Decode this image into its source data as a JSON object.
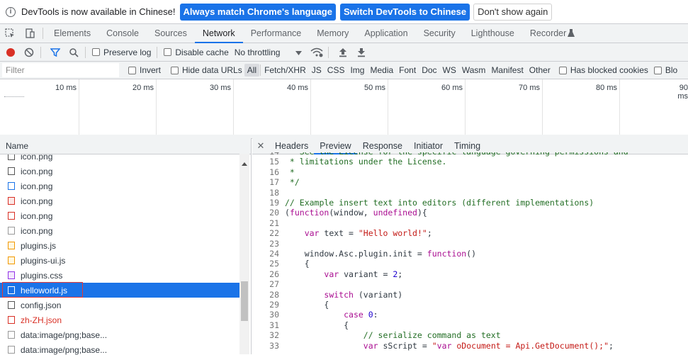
{
  "infobar": {
    "message": "DevTools is now available in Chinese!",
    "btn_match": "Always match Chrome's language",
    "btn_switch": "Switch DevTools to Chinese",
    "btn_dont": "Don't show again"
  },
  "tabs": [
    "Elements",
    "Console",
    "Sources",
    "Network",
    "Performance",
    "Memory",
    "Application",
    "Security",
    "Lighthouse",
    "Recorder"
  ],
  "active_tab": "Network",
  "toolbar": {
    "preserve_log": "Preserve log",
    "disable_cache": "Disable cache",
    "throttling": "No throttling"
  },
  "filterbar": {
    "placeholder": "Filter",
    "invert": "Invert",
    "hide_data_urls": "Hide data URLs",
    "types": [
      "All",
      "Fetch/XHR",
      "JS",
      "CSS",
      "Img",
      "Media",
      "Font",
      "Doc",
      "WS",
      "Wasm",
      "Manifest",
      "Other"
    ],
    "has_blocked_cookies": "Has blocked cookies",
    "blocked_trunc": "Blo"
  },
  "overview": {
    "ticks": [
      "10 ms",
      "20 ms",
      "30 ms",
      "40 ms",
      "50 ms",
      "60 ms",
      "70 ms",
      "80 ms",
      "90 ms"
    ]
  },
  "list": {
    "header": "Name",
    "items": [
      {
        "name": "icon.png",
        "type": "img"
      },
      {
        "name": "icon.png",
        "type": "img"
      },
      {
        "name": "icon.png",
        "type": "img"
      },
      {
        "name": "icon.png",
        "type": "img"
      },
      {
        "name": "icon.png",
        "type": "img"
      },
      {
        "name": "icon.png",
        "type": "img"
      },
      {
        "name": "plugins.js",
        "type": "js"
      },
      {
        "name": "plugins-ui.js",
        "type": "js"
      },
      {
        "name": "plugins.css",
        "type": "css"
      },
      {
        "name": "helloworld.js",
        "type": "js",
        "selected": true
      },
      {
        "name": "config.json",
        "type": "doc"
      },
      {
        "name": "zh-ZH.json",
        "type": "err"
      },
      {
        "name": "data:image/png;base...",
        "type": "img"
      },
      {
        "name": "data:image/png;base...",
        "type": "img"
      }
    ]
  },
  "detail": {
    "tabs": [
      "Headers",
      "Preview",
      "Response",
      "Initiator",
      "Timing"
    ],
    "active_tab": "Preview",
    "lines": [
      {
        "n": "14",
        "t": " * See the License for the specific language governing permissions and",
        "cls": "com"
      },
      {
        "n": "15",
        "t": " * limitations under the License.",
        "cls": "com"
      },
      {
        "n": "16",
        "t": " *",
        "cls": "com"
      },
      {
        "n": "17",
        "t": " */",
        "cls": "com"
      },
      {
        "n": "18",
        "t": "",
        "cls": ""
      },
      {
        "n": "19",
        "t": "// Example insert text into editors (different implementations)",
        "cls": "com"
      },
      {
        "n": "20",
        "t": "(function(window, undefined){",
        "cls": "mix1"
      },
      {
        "n": "21",
        "t": "",
        "cls": ""
      },
      {
        "n": "22",
        "t": "    var text = \"Hello world!\";",
        "cls": "mix2"
      },
      {
        "n": "23",
        "t": "",
        "cls": ""
      },
      {
        "n": "24",
        "t": "    window.Asc.plugin.init = function()",
        "cls": "mix3"
      },
      {
        "n": "25",
        "t": "    {",
        "cls": ""
      },
      {
        "n": "26",
        "t": "        var variant = 2;",
        "cls": "mix4"
      },
      {
        "n": "27",
        "t": "",
        "cls": ""
      },
      {
        "n": "28",
        "t": "        switch (variant)",
        "cls": "mix5"
      },
      {
        "n": "29",
        "t": "        {",
        "cls": ""
      },
      {
        "n": "30",
        "t": "            case 0:",
        "cls": "mix6"
      },
      {
        "n": "31",
        "t": "            {",
        "cls": ""
      },
      {
        "n": "32",
        "t": "                // serialize command as text",
        "cls": "com"
      },
      {
        "n": "33",
        "t": "                var sScript = \"var oDocument = Api.GetDocument();\";",
        "cls": "mix7"
      }
    ]
  },
  "colors": {
    "accent": "#1a73e8",
    "error": "#d93025",
    "comment": "#236e25",
    "keyword": "#aa0d91",
    "string": "#c41a16"
  }
}
